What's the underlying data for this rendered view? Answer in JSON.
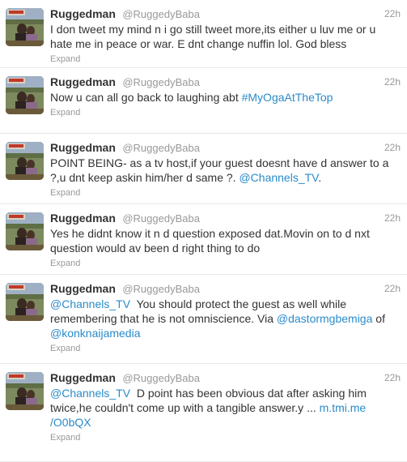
{
  "user": {
    "fullname": "Ruggedman",
    "username": "@RuggedyBaba"
  },
  "expand_label": "Expand",
  "tweets": [
    {
      "time": "22h",
      "lines": [
        [
          {
            "t": "I don tweet my mind n i go still tweet more,its either u luv me or u"
          }
        ],
        [
          {
            "t": "hate me in peace or war. E dnt change nuffin lol. God bless"
          }
        ]
      ]
    },
    {
      "time": "22h",
      "lines": [
        [
          {
            "t": "Now u can all go back to laughing abt "
          },
          {
            "t": "#MyOgaAtTheTop",
            "link": true
          }
        ]
      ]
    },
    {
      "time": "22h",
      "lines": [
        [
          {
            "t": "POINT BEING- as a tv host,if your guest doesnt have d answer to a"
          }
        ],
        [
          {
            "t": "?,u dnt keep askin him/her d same ?. "
          },
          {
            "t": "@Channels_TV",
            "link": true
          },
          {
            "t": "."
          }
        ]
      ]
    },
    {
      "time": "22h",
      "lines": [
        [
          {
            "t": "Yes he didnt know it n d question exposed dat.Movin on to d nxt"
          }
        ],
        [
          {
            "t": "question would av been d right thing to do"
          }
        ]
      ]
    },
    {
      "time": "22h",
      "lines": [
        [
          {
            "t": "@Channels_TV",
            "link": true
          },
          {
            "t": "  You should protect the guest as well while"
          }
        ],
        [
          {
            "t": "remembering that he is not omniscience. Via "
          },
          {
            "t": "@dastormgbemiga",
            "link": true
          },
          {
            "t": " of"
          }
        ],
        [
          {
            "t": "@konknaijamedia",
            "link": true
          }
        ]
      ]
    },
    {
      "time": "22h",
      "lines": [
        [
          {
            "t": "@Channels_TV",
            "link": true
          },
          {
            "t": "  D point has been obvious dat after asking him"
          }
        ],
        [
          {
            "t": "twice,he couldn't come up with a tangible answer.y ... "
          },
          {
            "t": "m.tmi.me",
            "link": true
          }
        ],
        [
          {
            "t": "/O0bQX",
            "link": true
          }
        ]
      ]
    }
  ],
  "colors": {
    "link": "#2a8bc9",
    "text": "#333333",
    "muted": "#999999",
    "divider": "#e8e8e8"
  }
}
